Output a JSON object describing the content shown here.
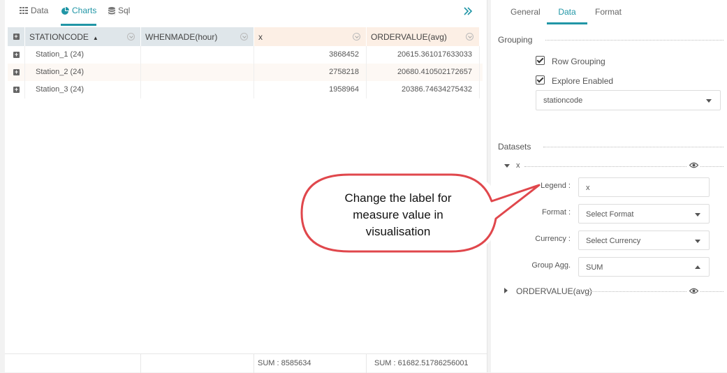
{
  "left_tabs": [
    {
      "label": "Data",
      "icon": "table-icon"
    },
    {
      "label": "Charts",
      "icon": "pie-chart-icon"
    },
    {
      "label": "Sql",
      "icon": "database-icon"
    }
  ],
  "grid": {
    "headers": [
      "STATIONCODE",
      "WHENMADE(hour)",
      "x",
      "ORDERVALUE(avg)"
    ],
    "rows": [
      {
        "station": "Station_1 (24)",
        "whenmade": "",
        "x": "3868452",
        "ordervalue": "20615.361017633033"
      },
      {
        "station": "Station_2 (24)",
        "whenmade": "",
        "x": "2758218",
        "ordervalue": "20680.410502172657"
      },
      {
        "station": "Station_3 (24)",
        "whenmade": "",
        "x": "1958964",
        "ordervalue": "20386.74634275432"
      }
    ],
    "footer": {
      "x_sum": "SUM : 8585634",
      "ordervalue_sum": "SUM : 61682.51786256001"
    }
  },
  "right_tabs": [
    "General",
    "Data",
    "Format"
  ],
  "grouping": {
    "title": "Grouping",
    "row_grouping": "Row Grouping",
    "explore_enabled": "Explore Enabled",
    "field": "stationcode"
  },
  "datasets": {
    "title": "Datasets",
    "first": {
      "name": "x",
      "legend_label": "Legend :",
      "legend_value": "x",
      "format_label": "Format :",
      "format_value": "Select Format",
      "currency_label": "Currency :",
      "currency_value": "Select Currency",
      "agg_label": "Group Agg.",
      "agg_value": "SUM"
    },
    "second": {
      "name": "ORDERVALUE(avg)"
    }
  },
  "callout": {
    "line1": "Change the label for",
    "line2": "measure value in",
    "line3": "visualisation"
  },
  "colors": {
    "accent": "#2196a6",
    "callout_border": "#e0474c",
    "highlight_header": "#fcefe5"
  }
}
